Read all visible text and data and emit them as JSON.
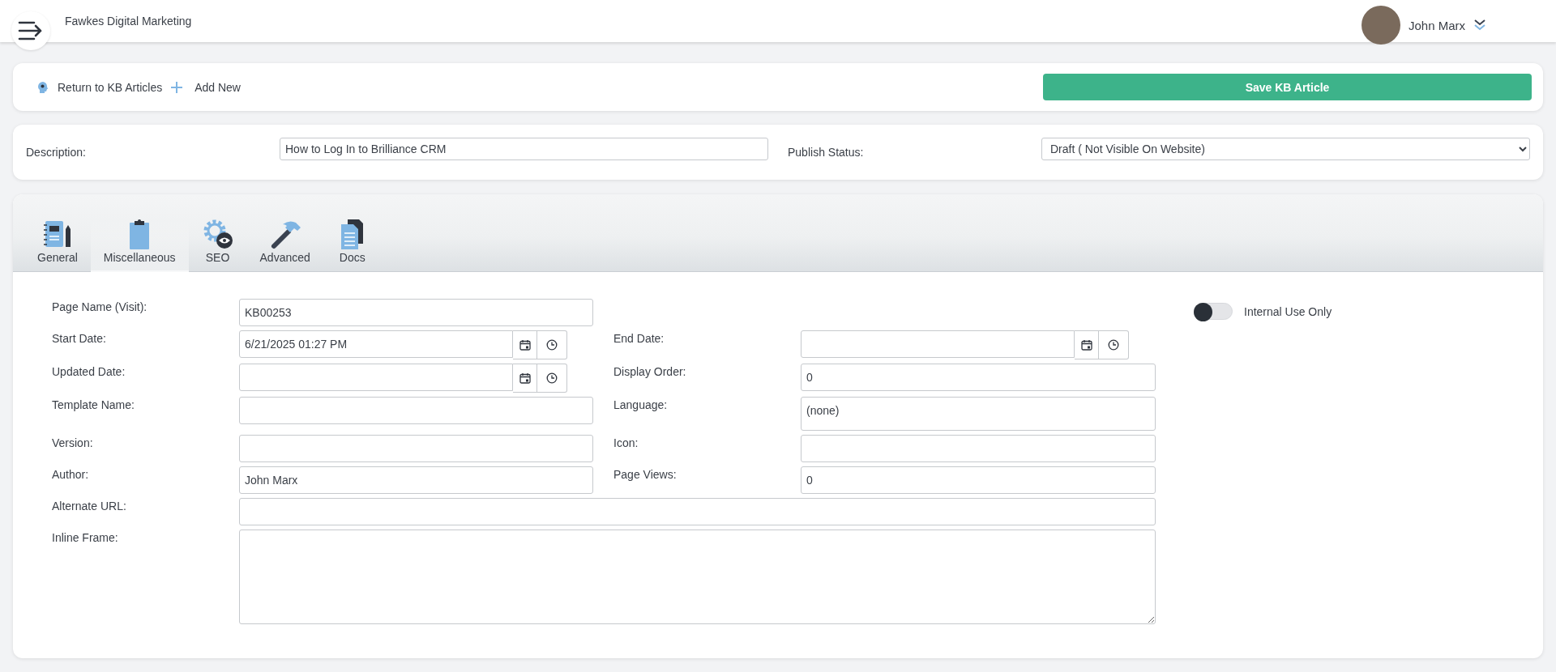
{
  "header": {
    "company": "Fawkes Digital Marketing",
    "user_name": "John Marx"
  },
  "toolbar": {
    "links": [
      "Return to KB Articles",
      "Add New"
    ],
    "save_button": "Save KB Article"
  },
  "description": {
    "label": "Description:",
    "value": "How to Log In to Brilliance CRM"
  },
  "publish_status": {
    "label": "Publish Status:",
    "value": "Draft ( Not Visible On Website)"
  },
  "tabs": [
    {
      "label": "General",
      "selected": false
    },
    {
      "label": "Miscellaneous",
      "selected": true
    },
    {
      "label": "SEO",
      "selected": false
    },
    {
      "label": "Advanced",
      "selected": false
    },
    {
      "label": "Docs",
      "selected": false
    }
  ],
  "form": {
    "internal_use": {
      "label": "Internal Use Only",
      "on": false
    },
    "rows": [
      {
        "fields": [
          {
            "kind": "text",
            "label": "Page Name (Visit):",
            "value": "KB00253"
          }
        ]
      },
      {
        "fields": [
          {
            "kind": "date",
            "label": "Start Date:",
            "value": "6/21/2025 01:27 PM"
          },
          {
            "kind": "date",
            "label": "End Date:"
          }
        ]
      },
      {
        "fields": [
          {
            "kind": "date",
            "label": "Updated Date:"
          },
          {
            "kind": "text",
            "label": "Display Order:",
            "value": "0"
          }
        ]
      },
      {
        "fields": [
          {
            "kind": "text",
            "label": "Template Name:"
          },
          {
            "kind": "listbox",
            "label": "Language:",
            "value": "(none)"
          }
        ]
      },
      {
        "fields": [
          {
            "kind": "text",
            "label": "Version:"
          },
          {
            "kind": "text",
            "label": "Icon:"
          }
        ]
      },
      {
        "fields": [
          {
            "kind": "text",
            "label": "Author:",
            "value": "John Marx"
          },
          {
            "kind": "text",
            "label": "Page Views:",
            "value": "0"
          }
        ]
      },
      {
        "fields": [
          {
            "kind": "wide-text",
            "label": "Alternate URL:"
          }
        ]
      },
      {
        "fields": [
          {
            "kind": "textarea",
            "label": "Inline Frame:"
          }
        ]
      }
    ]
  }
}
